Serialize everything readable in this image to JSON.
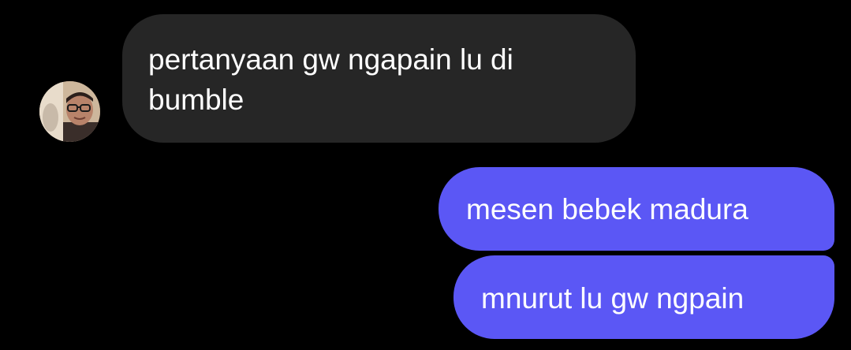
{
  "conversation": {
    "messages": [
      {
        "direction": "incoming",
        "text": "pertanyaan gw ngapain lu di bumble",
        "avatar": "contact-profile-photo"
      },
      {
        "direction": "outgoing",
        "text": "mesen bebek madura"
      },
      {
        "direction": "outgoing",
        "text": "mnurut lu gw ngpain"
      }
    ]
  },
  "colors": {
    "background": "#000000",
    "incoming_bubble": "#262626",
    "outgoing_bubble": "#5b57f5",
    "text": "#ffffff"
  }
}
